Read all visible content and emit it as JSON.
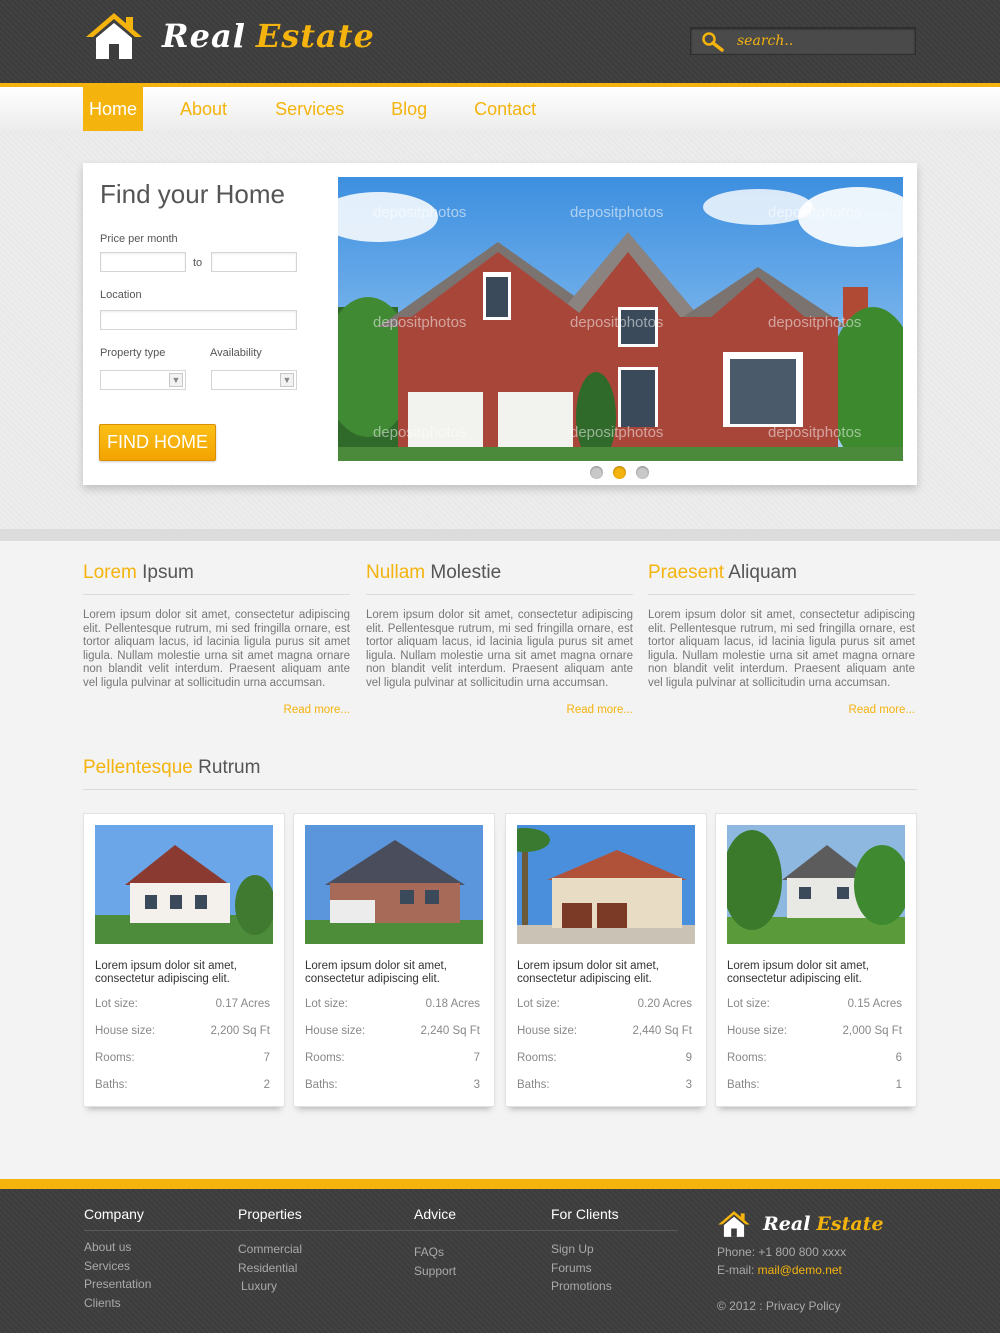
{
  "brand": {
    "word1": "Real",
    "word2": "Estate"
  },
  "search": {
    "placeholder": "search.."
  },
  "nav": [
    "Home",
    "About",
    "Services",
    "Blog",
    "Contact"
  ],
  "hero": {
    "title": "Find your Home",
    "price_label": "Price per month",
    "to_label": "to",
    "location_label": "Location",
    "property_type_label": "Property type",
    "availability_label": "Availability",
    "button": "FIND HOME",
    "watermark": "depositphotos"
  },
  "columns": [
    {
      "title_hl": "Lorem",
      "title_rest": " Ipsum",
      "text": "Lorem ipsum dolor sit amet, consectetur adipiscing elit. Pellentesque rutrum, mi sed fringilla ornare, est tortor aliquam lacus, id lacinia ligula purus sit amet ligula. Nullam molestie urna sit amet magna ornare non blandit velit interdum. Praesent aliquam ante vel ligula pulvinar at sollicitudin urna accumsan.",
      "more": "Read more..."
    },
    {
      "title_hl": "Nullam",
      "title_rest": " Molestie",
      "text": "Lorem ipsum dolor sit amet, consectetur adipiscing elit. Pellentesque rutrum, mi sed fringilla ornare, est tortor aliquam lacus, id lacinia ligula purus sit amet ligula. Nullam molestie urna sit amet magna ornare non blandit velit interdum. Praesent aliquam ante vel ligula pulvinar at sollicitudin urna accumsan.",
      "more": "Read more..."
    },
    {
      "title_hl": "Praesent",
      "title_rest": " Aliquam",
      "text": "Lorem ipsum dolor sit amet, consectetur adipiscing elit. Pellentesque rutrum, mi sed fringilla ornare, est tortor aliquam lacus, id lacinia ligula purus sit amet ligula. Nullam molestie urna sit amet magna ornare non blandit velit interdum. Praesent aliquam ante vel ligula pulvinar at sollicitudin urna accumsan.",
      "more": "Read more..."
    }
  ],
  "listings_title": {
    "hl": "Pellentesque",
    "rest": " Rutrum"
  },
  "listing_labels": {
    "lot": "Lot size:",
    "house": "House size:",
    "rooms": "Rooms:",
    "baths": "Baths:"
  },
  "listings": [
    {
      "title": "Lorem ipsum dolor sit amet, consectetur adipiscing elit.",
      "lot": "0.17 Acres",
      "house": "2,200 Sq Ft",
      "rooms": "7",
      "baths": "2"
    },
    {
      "title": "Lorem ipsum dolor sit amet, consectetur adipiscing elit.",
      "lot": "0.18 Acres",
      "house": "2,240 Sq Ft",
      "rooms": "7",
      "baths": "3"
    },
    {
      "title": "Lorem ipsum dolor sit amet, consectetur adipiscing elit.",
      "lot": "0.20 Acres",
      "house": "2,440 Sq Ft",
      "rooms": "9",
      "baths": "3"
    },
    {
      "title": "Lorem ipsum dolor sit amet, consectetur adipiscing elit.",
      "lot": "0.15 Acres",
      "house": "2,000 Sq Ft",
      "rooms": "6",
      "baths": "1"
    }
  ],
  "footer": {
    "company": {
      "title": "Company",
      "links": [
        "About us",
        "Services",
        "Presentation",
        "Clients"
      ]
    },
    "properties": {
      "title": "Properties",
      "links": [
        "Commercial",
        "Residential",
        "Luxury"
      ]
    },
    "advice": {
      "title": "Advice",
      "links": [
        "FAQs",
        "Support"
      ]
    },
    "clients": {
      "title": "For Clients",
      "links": [
        "Sign Up",
        "Forums",
        "Promotions"
      ]
    },
    "phone": "Phone: +1 800 800 xxxx",
    "email_label": "E-mail: ",
    "email": "mail@demo.net",
    "copyright": "© 2012 : Privacy Policy"
  },
  "colors": {
    "accent": "#f5b30d",
    "dark": "#3c3c3c"
  },
  "icons": [
    "house-icon",
    "search-icon",
    "chevron-down-icon"
  ]
}
